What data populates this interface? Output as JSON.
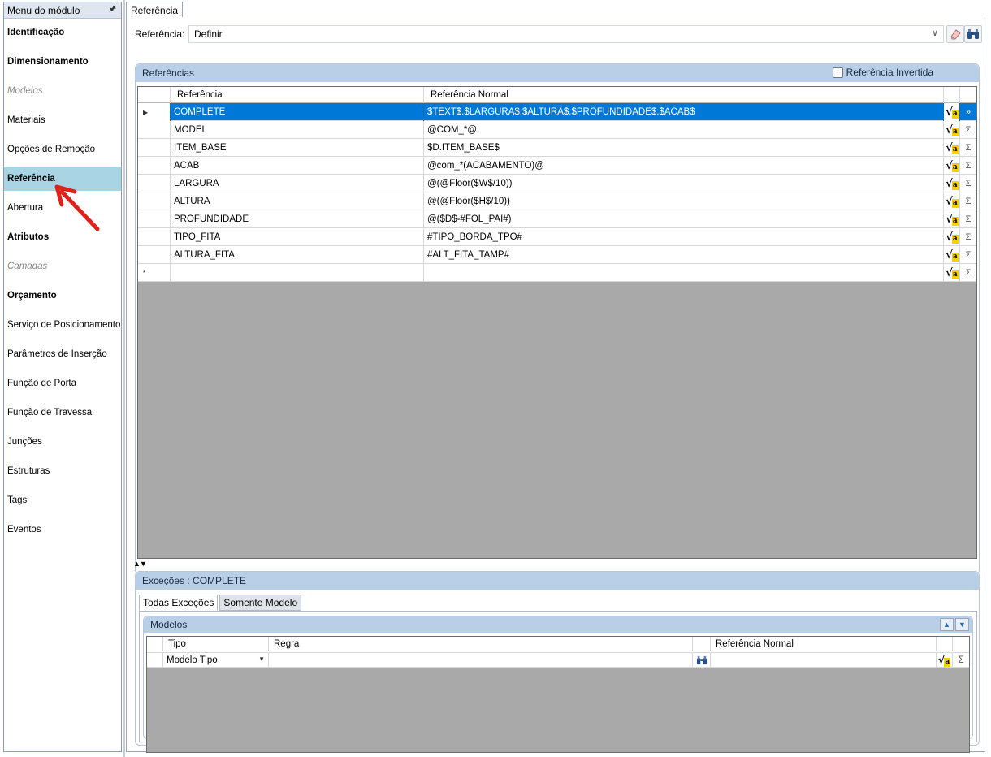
{
  "sidebar": {
    "title": "Menu do módulo",
    "pin_icon": "pin-icon",
    "items": [
      {
        "label": "Identificação",
        "style": "bold"
      },
      {
        "label": "Dimensionamento",
        "style": "bold"
      },
      {
        "label": "Modelos",
        "style": "disabled"
      },
      {
        "label": "Materiais",
        "style": "normal"
      },
      {
        "label": "Opções de Remoção",
        "style": "normal"
      },
      {
        "label": "Referência",
        "style": "active"
      },
      {
        "label": "Abertura",
        "style": "normal"
      },
      {
        "label": "Atributos",
        "style": "bold"
      },
      {
        "label": "Camadas",
        "style": "disabled"
      },
      {
        "label": "Orçamento",
        "style": "bold"
      },
      {
        "label": "Serviço de Posicionamento",
        "style": "normal"
      },
      {
        "label": "Parâmetros de Inserção",
        "style": "normal"
      },
      {
        "label": "Função de Porta",
        "style": "normal"
      },
      {
        "label": "Função de Travessa",
        "style": "normal"
      },
      {
        "label": "Junções",
        "style": "normal"
      },
      {
        "label": "Estruturas",
        "style": "normal"
      },
      {
        "label": "Tags",
        "style": "normal"
      },
      {
        "label": "Eventos",
        "style": "normal"
      }
    ],
    "annotation_color": "#e0201b"
  },
  "main": {
    "tab": "Referência",
    "reference_label": "Referência:",
    "reference_value": "Definir",
    "icons": [
      "chevron-down-icon",
      "eraser-icon",
      "binoculars-icon"
    ]
  },
  "references": {
    "title": "Referências",
    "inverted_label": "Referência Invertida",
    "inverted_checked": false,
    "columns": [
      "Referência",
      "Referência Normal"
    ],
    "rows": [
      {
        "name": "COMPLETE",
        "normal": "$TEXT$.$LARGURA$.$ALTURA$.$PROFUNDIDADE$.$ACAB$",
        "selected": true
      },
      {
        "name": "MODEL",
        "normal": "@COM_*@"
      },
      {
        "name": "ITEM_BASE",
        "normal": "$D.ITEM_BASE$"
      },
      {
        "name": "ACAB",
        "normal": "@com_*(ACABAMENTO)@"
      },
      {
        "name": "LARGURA",
        "normal": "@(@Floor($W$/10))"
      },
      {
        "name": "ALTURA",
        "normal": "@(@Floor($H$/10))"
      },
      {
        "name": "PROFUNDIDADE",
        "normal": "@($D$-#FOL_PAI#)"
      },
      {
        "name": "TIPO_FITA",
        "normal": "#TIPO_BORDA_TPO#"
      },
      {
        "name": "ALTURA_FITA",
        "normal": "#ALT_FITA_TAMP#"
      }
    ],
    "new_row_marker": "*",
    "current_row_marker": "▶",
    "sigma": "Σ",
    "expand": "»",
    "selection_color": "#0078d7"
  },
  "exceptions": {
    "title": "Exceções : COMPLETE",
    "tabs": [
      "Todas Exceções",
      "Somente Modelo"
    ],
    "models": {
      "title": "Modelos",
      "columns": [
        "Tipo",
        "Regra",
        "Referência Normal"
      ],
      "row": {
        "tipo": "Modelo Tipo"
      }
    }
  }
}
